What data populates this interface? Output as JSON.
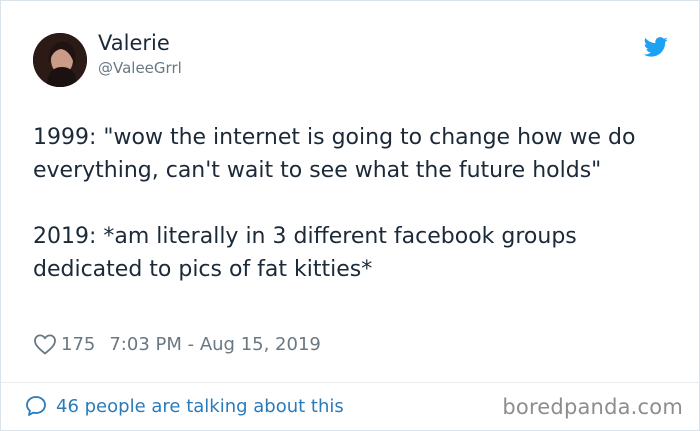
{
  "author": {
    "display_name": "Valerie",
    "handle": "@ValeeGrrl"
  },
  "tweet": {
    "text": "1999: \"wow the internet is going to change how we do everything, can't wait to see what the future holds\"\n\n2019: *am literally in 3 different facebook groups dedicated to pics of fat kitties*",
    "likes": "175",
    "timestamp": "7:03 PM - Aug 15, 2019"
  },
  "footer": {
    "talking_text": "46 people are talking about this"
  },
  "watermark": "boredpanda.com",
  "icons": {
    "platform": "twitter-bird-icon",
    "like": "heart-icon",
    "reply": "speech-bubble-icon"
  },
  "colors": {
    "text": "#1c2938",
    "muted": "#697882",
    "accent": "#1da1f2",
    "link": "#2b7bb9"
  }
}
